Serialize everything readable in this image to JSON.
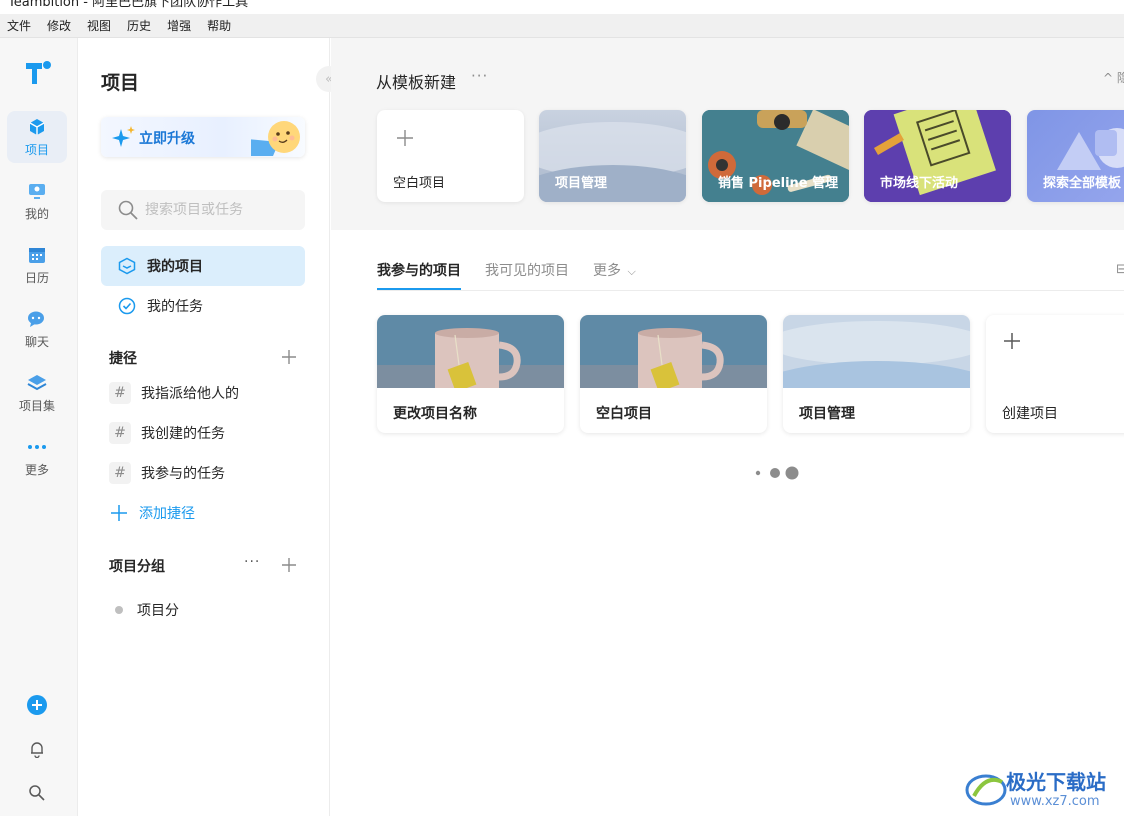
{
  "window": {
    "title": "Teambition - 阿里巴巴旗下团队协作工具"
  },
  "menu": [
    "文件",
    "修改",
    "视图",
    "历史",
    "增强",
    "帮助"
  ],
  "rail": {
    "items": [
      {
        "label": "项目",
        "icon": "cube-icon",
        "active": true
      },
      {
        "label": "我的",
        "icon": "monitor-icon"
      },
      {
        "label": "日历",
        "icon": "calendar-icon"
      },
      {
        "label": "聊天",
        "icon": "chat-icon"
      },
      {
        "label": "项目集",
        "icon": "layers-icon"
      },
      {
        "label": "更多",
        "icon": "more-dots-icon"
      }
    ],
    "bottom_icons": [
      "add-circle-icon",
      "bell-icon",
      "search-icon"
    ]
  },
  "sidebar": {
    "title": "项目",
    "collapse_icon": "«",
    "upgrade_label": "立即升级",
    "search_placeholder": "搜索项目或任务",
    "nav": [
      {
        "label": "我的项目",
        "icon": "project-icon",
        "active": true
      },
      {
        "label": "我的任务",
        "icon": "check-circle-icon"
      }
    ],
    "shortcuts_header": "捷径",
    "shortcuts": [
      "我指派给他人的",
      "我创建的任务",
      "我参与的任务"
    ],
    "hash_symbol": "#",
    "add_shortcut": "添加捷径",
    "groups_header": "项目分组",
    "group_more": "···",
    "groups": [
      "项目分"
    ]
  },
  "templates": {
    "title": "从模板新建",
    "more": "···",
    "hide_label": "^ 隐",
    "cards": [
      {
        "label": "空白项目",
        "kind": "blank"
      },
      {
        "label": "项目管理",
        "kind": "soft"
      },
      {
        "label": "销售 Pipeline 管理",
        "kind": "tools"
      },
      {
        "label": "市场线下活动",
        "kind": "poster"
      },
      {
        "label": "探索全部模板",
        "kind": "shapes"
      }
    ]
  },
  "tabs": {
    "items": [
      "我参与的项目",
      "我可见的项目",
      "更多"
    ],
    "more_chevron": "⌵",
    "right_label": "⊟"
  },
  "projects": [
    {
      "name": "更改项目名称",
      "cover": "mug"
    },
    {
      "name": "空白项目",
      "cover": "mug"
    },
    {
      "name": "项目管理",
      "cover": "soft"
    },
    {
      "name": "创建项目",
      "cover": "create"
    }
  ],
  "watermark": {
    "brand": "极光下载站",
    "url": "www.xz7.com"
  },
  "colors": {
    "accent": "#1b9aee",
    "active_bg": "#dbeefc",
    "band": "#f5f5f5"
  }
}
